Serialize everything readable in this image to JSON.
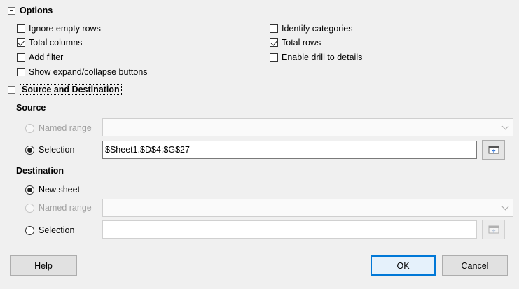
{
  "options": {
    "title": "Options",
    "checkboxes": [
      {
        "label": "Ignore empty rows",
        "checked": false
      },
      {
        "label": "Total columns",
        "checked": true
      },
      {
        "label": "Add filter",
        "checked": false
      },
      {
        "label": "Show expand/collapse buttons",
        "checked": false
      },
      {
        "label": "Identify categories",
        "checked": false
      },
      {
        "label": "Total rows",
        "checked": true
      },
      {
        "label": "Enable drill to details",
        "checked": false
      }
    ]
  },
  "source_destination": {
    "title": "Source and Destination",
    "source": {
      "title": "Source",
      "named_range_label": "Named range",
      "named_range_value": "",
      "selection_label": "Selection",
      "selection_value": "$Sheet1.$D$4:$G$27",
      "selected": "selection"
    },
    "destination": {
      "title": "Destination",
      "new_sheet_label": "New sheet",
      "named_range_label": "Named range",
      "named_range_value": "",
      "selection_label": "Selection",
      "selection_value": "",
      "selected": "new_sheet"
    }
  },
  "buttons": {
    "help": "Help",
    "ok": "OK",
    "cancel": "Cancel"
  },
  "colors": {
    "accent": "#0078d7"
  },
  "icons": {
    "section_toggle": "collapse-minus-icon",
    "shrink": "shrink-dialog-icon",
    "dropdown": "chevron-down-icon"
  }
}
